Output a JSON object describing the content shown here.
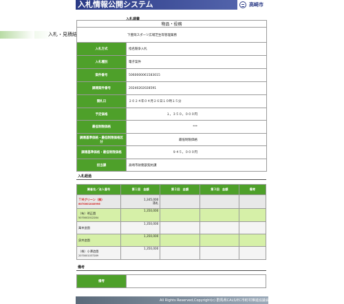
{
  "header": {
    "title": "入札情報公開システム",
    "city": "高崎市"
  },
  "section_bid": "入札調書",
  "banner": "入札・見積結果情報の詳細",
  "category": "物品・役務",
  "subject": "下豊岡スポーツ広場芝生等管理業務",
  "details": [
    {
      "label": "入札方式",
      "value": "指名競争入札"
    },
    {
      "label": "入札種別",
      "value": "電子案件"
    },
    {
      "label": "案件番号",
      "value": "5060000061583015"
    },
    {
      "label": "調達案件番号",
      "value": "20240202028591"
    },
    {
      "label": "開札日",
      "value": "２０２４年０４月２６日１０時１５分"
    },
    {
      "label": "予定価格",
      "value": "１，３５０，０００円"
    },
    {
      "label": "最低制限価格",
      "value": "***"
    },
    {
      "label": "調達基準価格・最低制限価格区分",
      "value": "最低制限価格"
    },
    {
      "label": "調達基準価格・最低制限価格",
      "value": "９４５，０００円"
    },
    {
      "label": "担当課",
      "value": "高崎市財務部契約課"
    }
  ],
  "section_progress": "入札経過",
  "progress_headers": [
    "業者名／法人番号",
    "第１回　金額",
    "第２回　金額",
    "第３回　金額",
    "備考"
  ],
  "progress_rows": [
    {
      "name": "ＴＭグリーン（株）",
      "id": "6070001040996",
      "amount": "1,345,000",
      "note": "落札"
    },
    {
      "name": "（有）明正園",
      "id": "5070002012284",
      "amount": "1,350,000",
      "note": ""
    },
    {
      "name": "萬幸造園",
      "id": "",
      "amount": "1,350,000",
      "note": ""
    },
    {
      "name": "泉井造園",
      "id": "",
      "amount": "1,350,000",
      "note": ""
    },
    {
      "name": "（株）小澤造園",
      "id": "2070001037289",
      "amount": "1,350,000",
      "note": ""
    }
  ],
  "section_notes": "備考",
  "notes_label": "備考",
  "footer": "All Rights Reserved,Copyright(c) 群馬県CALS/EC市町村推進協議会",
  "colors": {
    "header": "#2a3a86",
    "label_green": "#4ea02a",
    "winner_red": "#d21e1e"
  }
}
